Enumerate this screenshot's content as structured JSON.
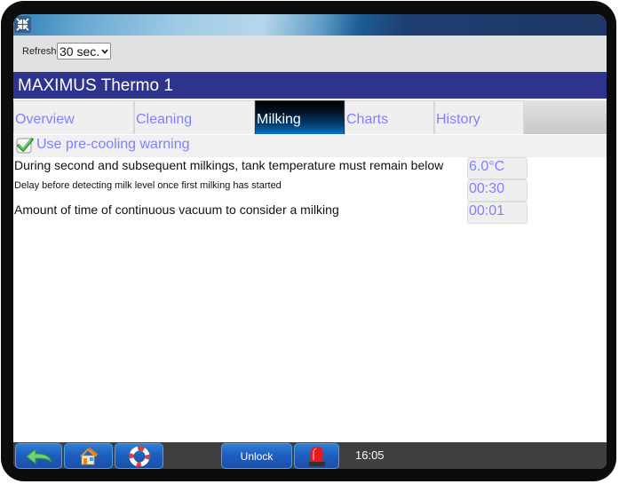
{
  "topbar": {
    "collapse_icon": "collapse-arrows-icon"
  },
  "refresh": {
    "label": "Refresh",
    "selected": "30 sec.",
    "dropdown_icon": "chevron-down-icon"
  },
  "title": "MAXIMUS Thermo 1",
  "tabs": [
    {
      "label": "Overview",
      "active": false
    },
    {
      "label": "Cleaning",
      "active": false
    },
    {
      "label": "Milking",
      "active": true
    },
    {
      "label": "Charts",
      "active": false
    },
    {
      "label": "History",
      "active": false
    }
  ],
  "option": {
    "label": "Use pre-cooling warning",
    "checked": true,
    "icon": "checkmark-icon"
  },
  "settings": [
    {
      "label": "During second and subsequent milkings, tank temperature must remain below",
      "value": "6.0°C"
    },
    {
      "label": "Delay before detecting milk level once first milking has started",
      "value": "00:30"
    },
    {
      "label": "Amount of time of continuous vacuum to consider a milking",
      "value": "00:01"
    }
  ],
  "bottombar": {
    "back_icon": "back-arrow-icon",
    "home_icon": "home-icon",
    "help_icon": "lifebuoy-icon",
    "unlock_label": "Unlock",
    "alarm_icon": "alarm-beacon-icon",
    "time": "16:05"
  },
  "colors": {
    "title_bar": "#2e348e",
    "tab_text": "#8080ff",
    "value_text": "#8080ff",
    "bottom_bar": "#3f3f3f"
  }
}
